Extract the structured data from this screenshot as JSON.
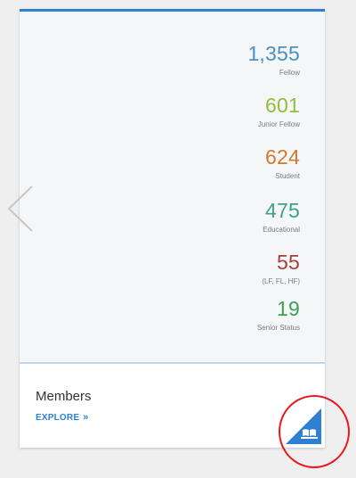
{
  "stats": [
    {
      "value": "1,355",
      "label": "Fellow",
      "color": "#4a8fc6"
    },
    {
      "value": "601",
      "label": "Junior Fellow",
      "color": "#8fbf3b"
    },
    {
      "value": "624",
      "label": "Student",
      "color": "#d07a2d"
    },
    {
      "value": "475",
      "label": "Educational",
      "color": "#3da08a"
    },
    {
      "value": "55",
      "label": "(LF, FL, HF)",
      "color": "#a3413a"
    },
    {
      "value": "19",
      "label": "Senior Status",
      "color": "#3aa156"
    }
  ],
  "section": {
    "title": "Members",
    "link_label": "EXPLORE",
    "link_chevron": "»"
  },
  "colors": {
    "accent": "#2f80d1",
    "highlight": "#e8191e"
  },
  "icons": {
    "prev": "chevron-left-icon",
    "badge": "book-icon"
  }
}
